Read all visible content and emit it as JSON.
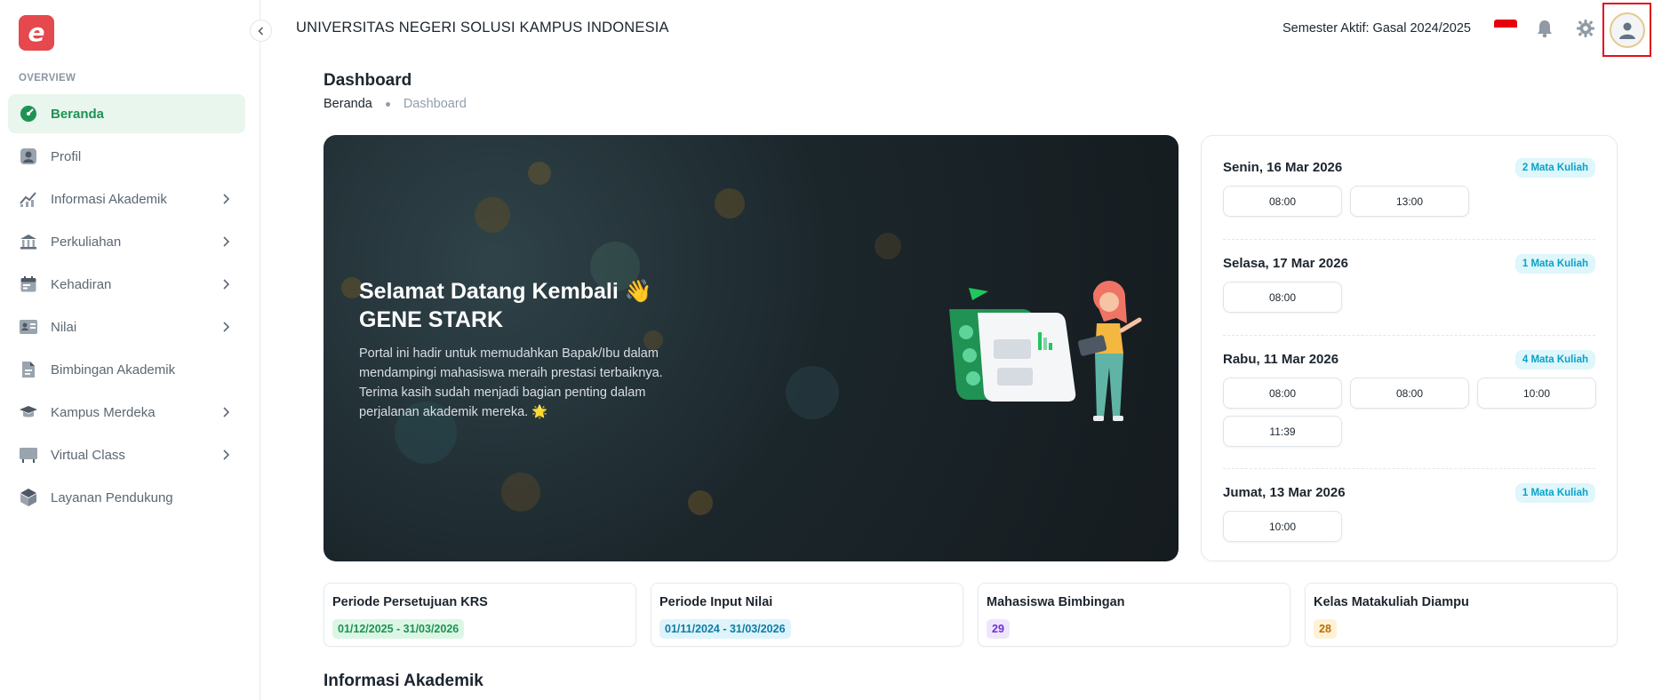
{
  "app": {
    "logo_letter": "e"
  },
  "sidebar": {
    "section_label": "OVERVIEW",
    "items": [
      {
        "label": "Beranda",
        "icon": "dashboard-icon",
        "active": true,
        "has_submenu": false
      },
      {
        "label": "Profil",
        "icon": "profile-icon",
        "active": false,
        "has_submenu": false
      },
      {
        "label": "Informasi Akademik",
        "icon": "chart-icon",
        "active": false,
        "has_submenu": true
      },
      {
        "label": "Perkuliahan",
        "icon": "institution-icon",
        "active": false,
        "has_submenu": true
      },
      {
        "label": "Kehadiran",
        "icon": "calendar-icon",
        "active": false,
        "has_submenu": true
      },
      {
        "label": "Nilai",
        "icon": "grade-card-icon",
        "active": false,
        "has_submenu": true
      },
      {
        "label": "Bimbingan Akademik",
        "icon": "document-icon",
        "active": false,
        "has_submenu": false
      },
      {
        "label": "Kampus Merdeka",
        "icon": "briefcase-icon",
        "active": false,
        "has_submenu": true
      },
      {
        "label": "Virtual Class",
        "icon": "board-icon",
        "active": false,
        "has_submenu": true
      },
      {
        "label": "Layanan Pendukung",
        "icon": "box-icon",
        "active": false,
        "has_submenu": false
      }
    ]
  },
  "header": {
    "university": "UNIVERSITAS NEGERI SOLUSI KAMPUS INDONESIA",
    "semester": "Semester Aktif: Gasal 2024/2025"
  },
  "page": {
    "title": "Dashboard",
    "breadcrumb": [
      "Beranda",
      "Dashboard"
    ]
  },
  "hero": {
    "greeting": "Selamat Datang Kembali 👋",
    "name": "GENE STARK",
    "description": "Portal ini hadir untuk memudahkan Bapak/Ibu dalam mendampingi mahasiswa meraih prestasi terbaiknya. Terima kasih sudah menjadi bagian penting dalam perjalanan akademik mereka. 🌟"
  },
  "schedule": [
    {
      "day": "Senin, 16 Mar 2026",
      "badge": "2 Mata Kuliah",
      "times": [
        "08:00",
        "13:00"
      ]
    },
    {
      "day": "Selasa, 17 Mar 2026",
      "badge": "1 Mata Kuliah",
      "times": [
        "08:00"
      ]
    },
    {
      "day": "Rabu, 11 Mar 2026",
      "badge": "4 Mata Kuliah",
      "times": [
        "08:00",
        "08:00",
        "10:00",
        "11:39"
      ]
    },
    {
      "day": "Jumat, 13 Mar 2026",
      "badge": "1 Mata Kuliah",
      "times": [
        "10:00"
      ]
    }
  ],
  "stats": [
    {
      "title": "Periode Persetujuan KRS",
      "value": "01/12/2025 - 31/03/2026",
      "color": "#1f9254",
      "bg": "#dcf6e5"
    },
    {
      "title": "Periode Input Nilai",
      "value": "01/11/2024 - 31/03/2026",
      "color": "#0b7ea3",
      "bg": "#dff3fb"
    },
    {
      "title": "Mahasiswa Bimbingan",
      "value": "29",
      "color": "#6d2fd6",
      "bg": "#efe6fd"
    },
    {
      "title": "Kelas Matakuliah Diampu",
      "value": "28",
      "color": "#b76e00",
      "bg": "#fff1d6"
    }
  ],
  "sections": {
    "informasi_akademik": "Informasi Akademik"
  },
  "colors": {
    "accent": "#1f9254",
    "logo": "#e5484d",
    "badge": "#06a3c9"
  }
}
